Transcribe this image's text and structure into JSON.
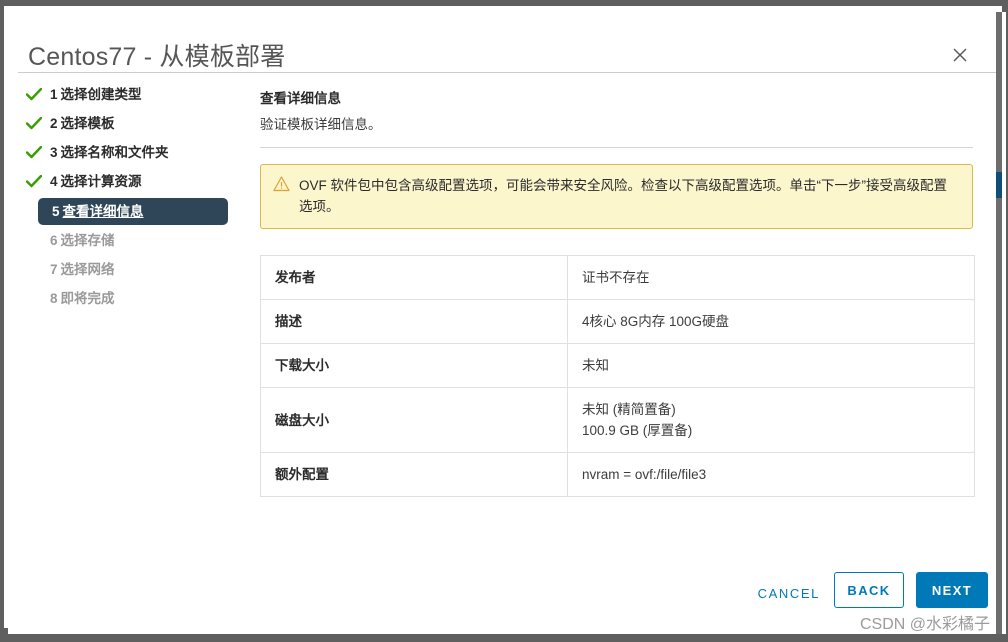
{
  "window": {
    "title": "Centos77 - 从模板部署",
    "close_icon": "close-icon"
  },
  "steps": [
    {
      "num": "1",
      "label": "选择创建类型",
      "state": "done"
    },
    {
      "num": "2",
      "label": "选择模板",
      "state": "done"
    },
    {
      "num": "3",
      "label": "选择名称和文件夹",
      "state": "done"
    },
    {
      "num": "4",
      "label": "选择计算资源",
      "state": "done"
    },
    {
      "num": "5",
      "label": "查看详细信息",
      "state": "current"
    },
    {
      "num": "6",
      "label": "选择存储",
      "state": "upcoming"
    },
    {
      "num": "7",
      "label": "选择网络",
      "state": "upcoming"
    },
    {
      "num": "8",
      "label": "即将完成",
      "state": "upcoming"
    }
  ],
  "content": {
    "title": "查看详细信息",
    "subtitle": "验证模板详细信息。",
    "warning": {
      "icon": "warning-triangle-icon",
      "text": "OVF 软件包中包含高级配置选项，可能会带来安全风险。检查以下高级配置选项。单击“下一步”接受高级配置选项。"
    },
    "table": {
      "rows": [
        {
          "label": "发布者",
          "values": [
            "证书不存在"
          ]
        },
        {
          "label": "描述",
          "values": [
            "4核心 8G内存 100G硬盘"
          ]
        },
        {
          "label": "下载大小",
          "values": [
            "未知"
          ]
        },
        {
          "label": "磁盘大小",
          "values": [
            "未知 (精简置备)",
            "100.9 GB (厚置备)"
          ]
        },
        {
          "label": "额外配置",
          "values": [
            "nvram = ovf:/file/file3"
          ]
        }
      ]
    }
  },
  "footer": {
    "cancel_label": "CANCEL",
    "back_label": "BACK",
    "next_label": "NEXT"
  },
  "watermark": "CSDN @水彩橘子",
  "colors": {
    "accent": "#0079b8",
    "step_active_bg": "#2e4657",
    "check_green": "#37a000",
    "warning_bg": "#fcf6cd",
    "warning_border": "#d6ba4a",
    "warning_icon": "#e8a33d",
    "scrollbar_thumb": "#0f4f77"
  }
}
